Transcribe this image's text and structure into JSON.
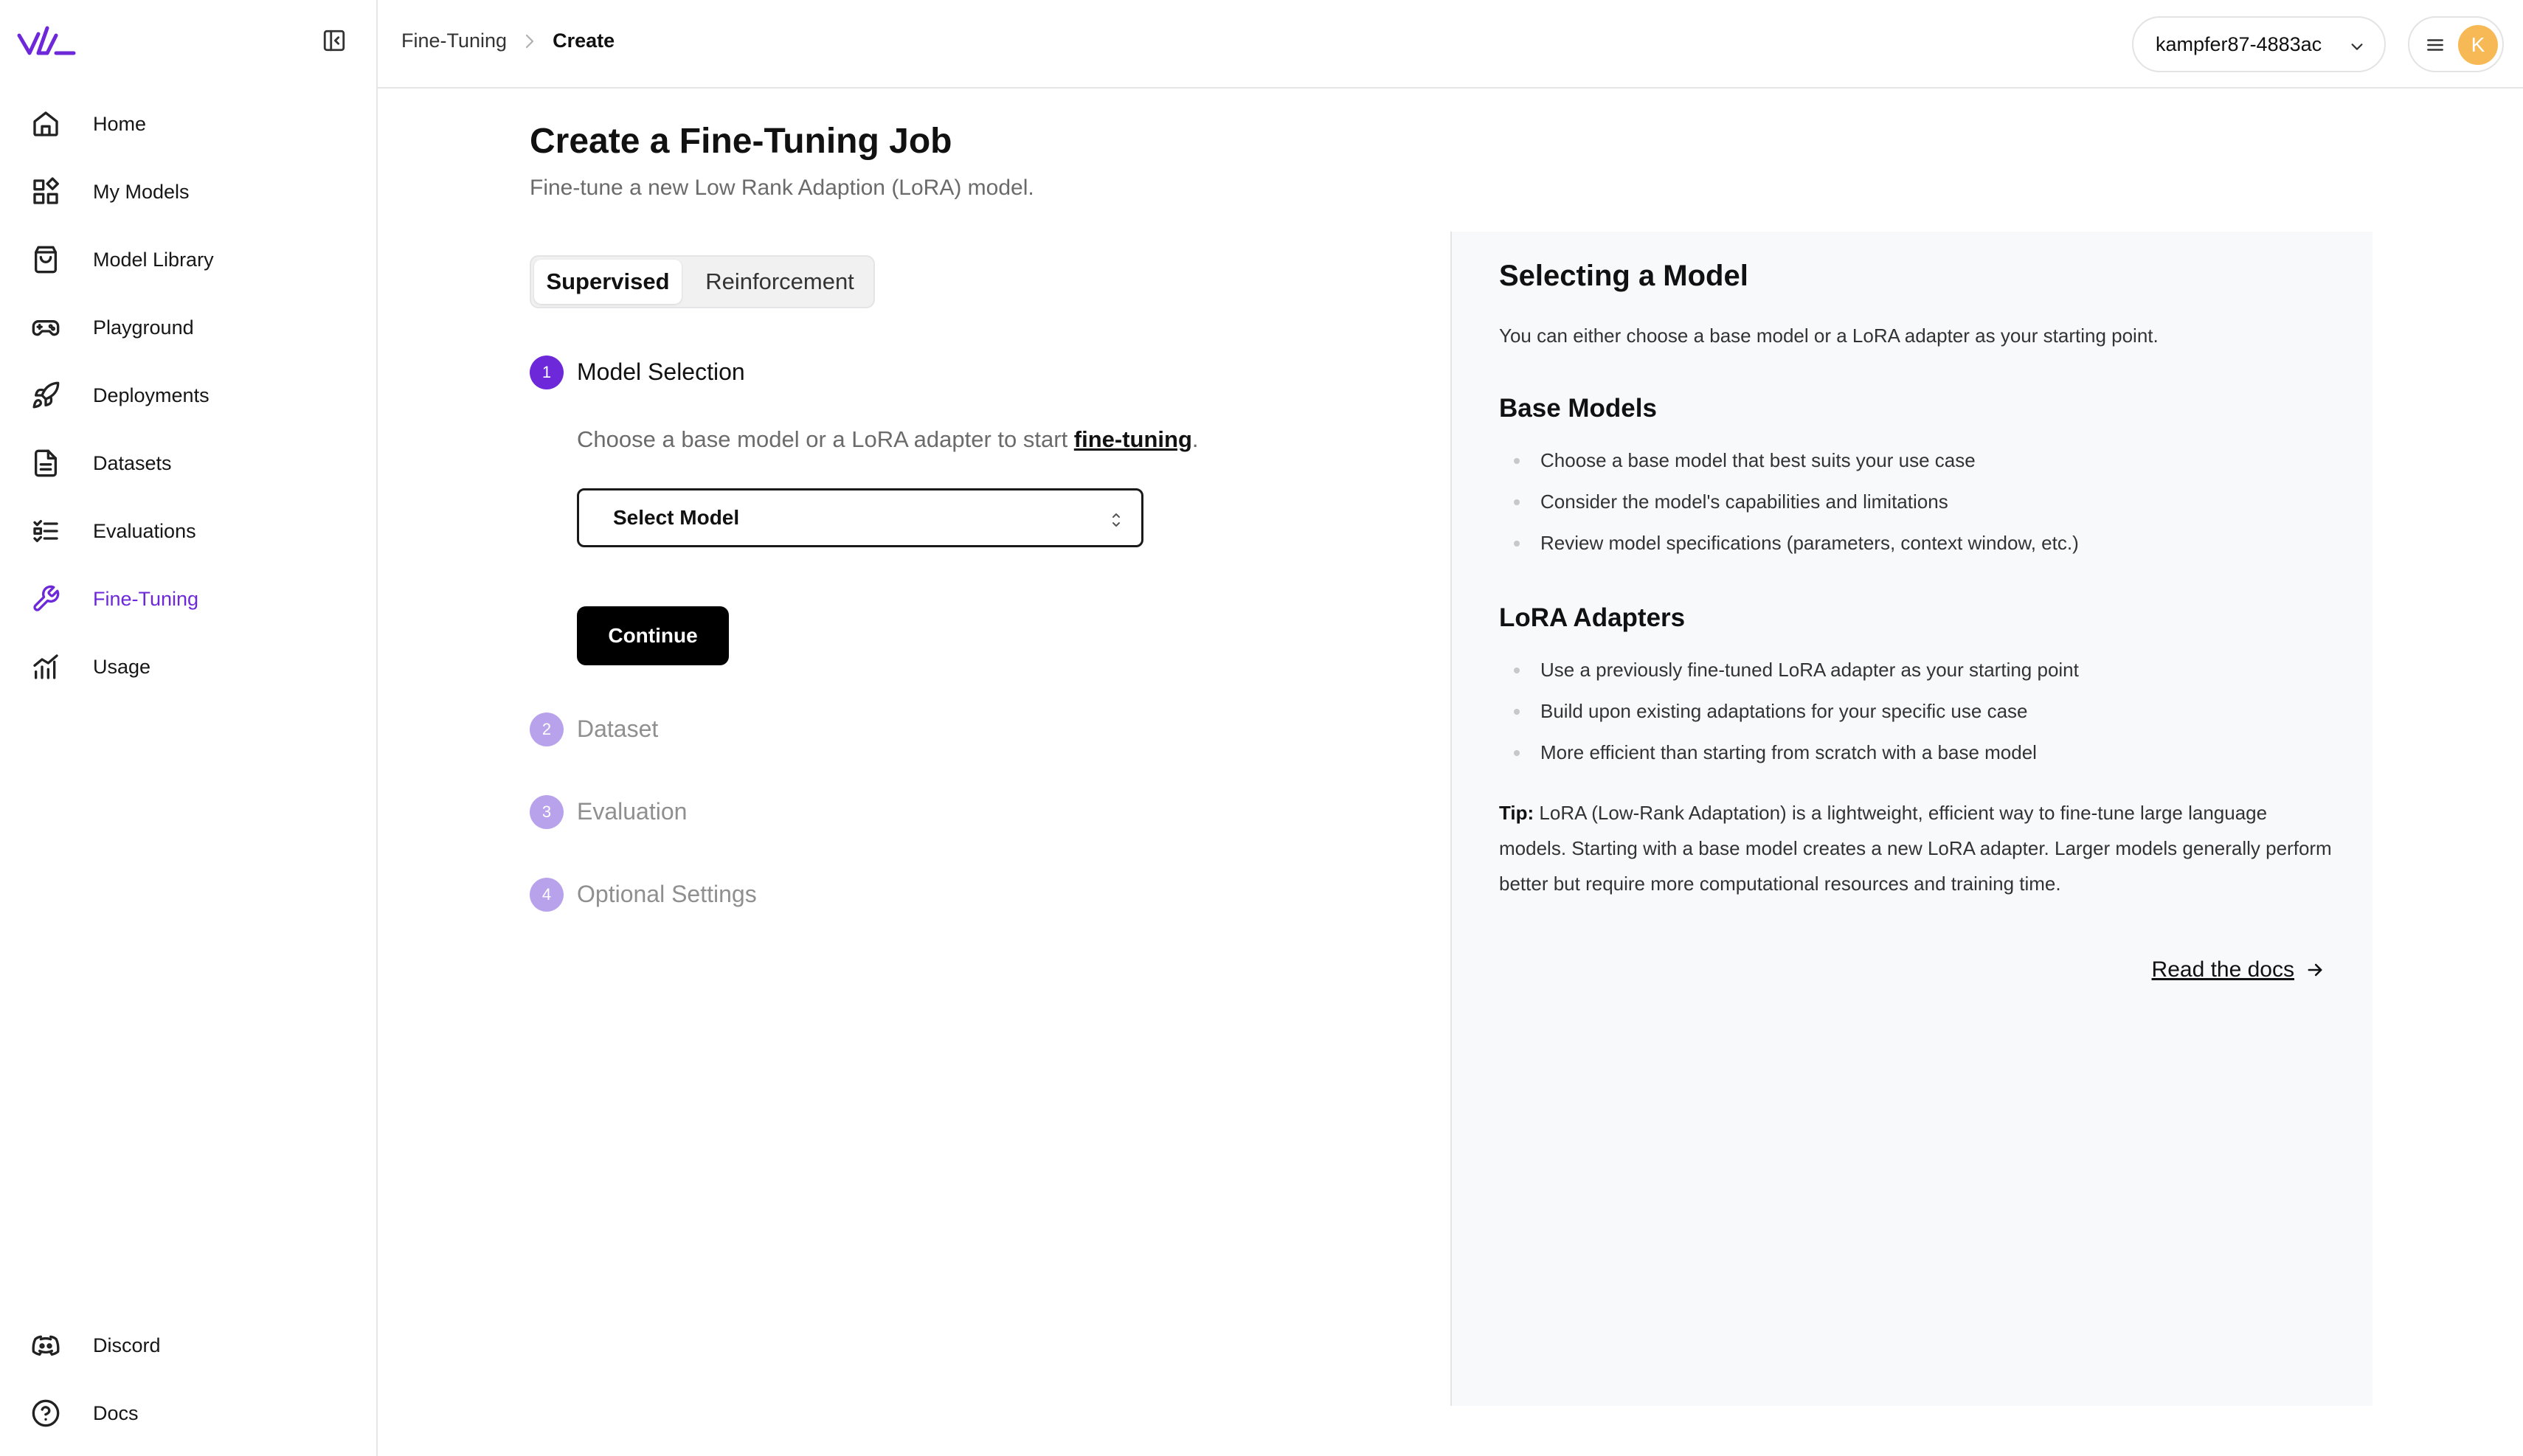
{
  "sidebar": {
    "items": [
      {
        "label": "Home",
        "icon": "home-icon"
      },
      {
        "label": "My Models",
        "icon": "models-grid-icon"
      },
      {
        "label": "Model Library",
        "icon": "shopping-bag-icon"
      },
      {
        "label": "Playground",
        "icon": "gamepad-icon"
      },
      {
        "label": "Deployments",
        "icon": "rocket-icon"
      },
      {
        "label": "Datasets",
        "icon": "file-text-icon"
      },
      {
        "label": "Evaluations",
        "icon": "checklist-icon"
      },
      {
        "label": "Fine-Tuning",
        "icon": "wrench-icon",
        "active": true
      },
      {
        "label": "Usage",
        "icon": "bar-chart-icon"
      }
    ],
    "bottom": [
      {
        "label": "Discord",
        "icon": "discord-icon"
      },
      {
        "label": "Docs",
        "icon": "help-circle-icon"
      }
    ]
  },
  "topbar": {
    "breadcrumb": [
      "Fine-Tuning",
      "Create"
    ],
    "account": "kampfer87-4883ac",
    "avatar_initial": "K"
  },
  "main": {
    "title": "Create a Fine-Tuning Job",
    "subtitle": "Fine-tune a new Low Rank Adaption (LoRA) model.",
    "tabs": [
      {
        "label": "Supervised",
        "active": true
      },
      {
        "label": "Reinforcement",
        "active": false
      }
    ],
    "steps": [
      {
        "num": "1",
        "label": "Model Selection",
        "active": true
      },
      {
        "num": "2",
        "label": "Dataset",
        "active": false
      },
      {
        "num": "3",
        "label": "Evaluation",
        "active": false
      },
      {
        "num": "4",
        "label": "Optional Settings",
        "active": false
      }
    ],
    "step_desc_prefix": "Choose a base model or a LoRA adapter to start ",
    "step_desc_link": "fine-tuning",
    "step_desc_suffix": ".",
    "model_select_placeholder": "Select Model",
    "continue_label": "Continue"
  },
  "help": {
    "title": "Selecting a Model",
    "intro": "You can either choose a base model or a LoRA adapter as your starting point.",
    "base_title": "Base Models",
    "base_items": [
      "Choose a base model that best suits your use case",
      "Consider the model's capabilities and limitations",
      "Review model specifications (parameters, context window, etc.)"
    ],
    "lora_title": "LoRA Adapters",
    "lora_items": [
      "Use a previously fine-tuned LoRA adapter as your starting point",
      "Build upon existing adaptations for your specific use case",
      "More efficient than starting from scratch with a base model"
    ],
    "tip_label": "Tip:",
    "tip_text": " LoRA (Low-Rank Adaptation) is a lightweight, efficient way to fine-tune large language models. Starting with a base model creates a new LoRA adapter. Larger models generally perform better but require more computational resources and training time.",
    "read_docs": "Read the docs"
  },
  "colors": {
    "accent": "#6d28d9",
    "step_pending": "#b8a2ec",
    "avatar": "#f7b955",
    "panel_bg": "#f8f9fb"
  }
}
